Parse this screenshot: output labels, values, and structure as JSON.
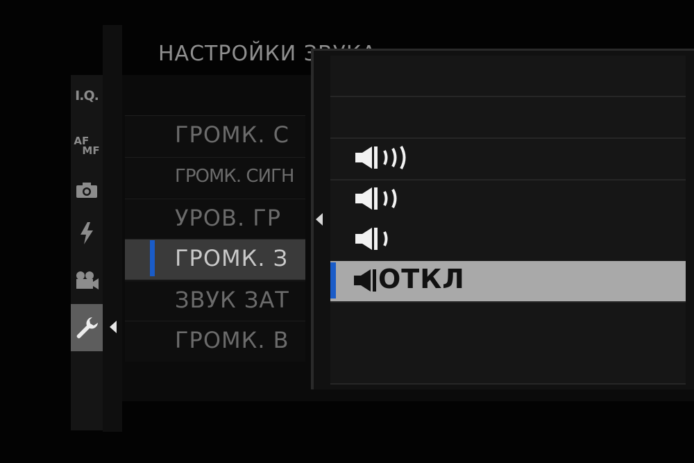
{
  "screen": {
    "title": "НАСТРОЙКИ ЗВУКА"
  },
  "tabs": [
    {
      "id": "iq",
      "label": "I.Q."
    },
    {
      "id": "afmf",
      "label_af": "AF",
      "label_mf": "MF"
    },
    {
      "id": "camera",
      "icon": "camera-icon"
    },
    {
      "id": "flash",
      "icon": "flash-icon"
    },
    {
      "id": "movie",
      "icon": "movie-camera-icon"
    },
    {
      "id": "setup",
      "icon": "wrench-icon",
      "active": true
    }
  ],
  "menu": {
    "items": [
      {
        "label": "ГРОМК. С"
      },
      {
        "label": "ГРОМК. СИГН"
      },
      {
        "label": "УРОВ. ГР"
      },
      {
        "label": "ГРОМК. З",
        "selected": true
      },
      {
        "label": "ЗВУК ЗАТ"
      },
      {
        "label": "ГРОМК. В"
      }
    ]
  },
  "popup": {
    "options": [
      {
        "id": "vol3",
        "icon": "volume-high-icon",
        "level": 3
      },
      {
        "id": "vol2",
        "icon": "volume-medium-icon",
        "level": 2
      },
      {
        "id": "vol1",
        "icon": "volume-low-icon",
        "level": 1
      },
      {
        "id": "off",
        "icon": "volume-off-icon",
        "label": "ОТКЛ",
        "selected": true
      }
    ]
  },
  "colors": {
    "accent": "#1a5cc8",
    "highlight": "#a9a9a9",
    "active_tab": "#5d5d5d"
  }
}
